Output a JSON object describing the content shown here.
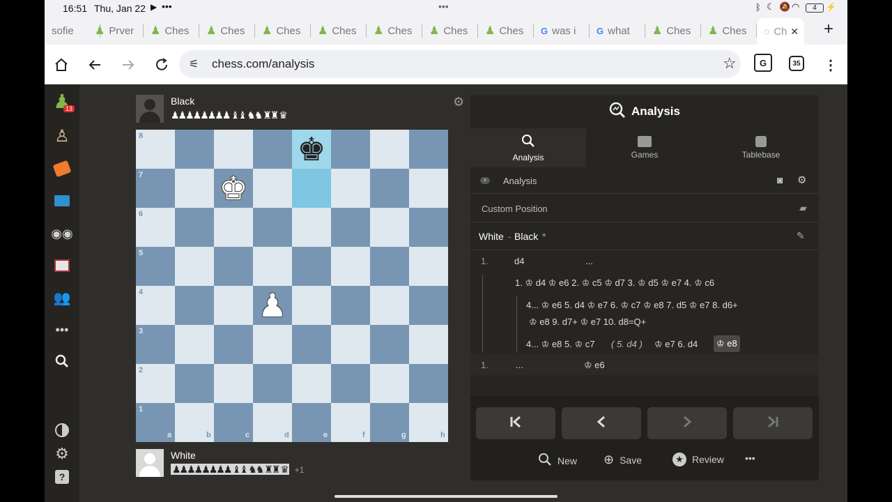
{
  "status": {
    "time": "16:51",
    "date": "Thu, Jan 22",
    "battery": "4"
  },
  "tabs": [
    {
      "label": "sofie"
    },
    {
      "label": "Prver"
    },
    {
      "label": "Ches"
    },
    {
      "label": "Ches"
    },
    {
      "label": "Ches"
    },
    {
      "label": "Ches"
    },
    {
      "label": "Ches"
    },
    {
      "label": "Ches"
    },
    {
      "label": "Ches"
    },
    {
      "label": "was i"
    },
    {
      "label": "what"
    },
    {
      "label": "Ches"
    },
    {
      "label": "Ches"
    },
    {
      "label": "Ch"
    }
  ],
  "browser": {
    "url": "chess.com/analysis",
    "tab_count": "35"
  },
  "sidebar": {
    "notification_badge": "13"
  },
  "players": {
    "black": {
      "name": "Black",
      "captured": "♟♟♟♟♟♟♟♟ ♝♝ ♞♞ ♜♜ ♛"
    },
    "white": {
      "name": "White",
      "captured": "♟♟♟♟♟♟♟♟ ♝♝ ♞♞ ♜♜ ♛",
      "advantage": "+1"
    }
  },
  "board": {
    "files": [
      "a",
      "b",
      "c",
      "d",
      "e",
      "f",
      "g",
      "h"
    ],
    "ranks": [
      "8",
      "7",
      "6",
      "5",
      "4",
      "3",
      "2",
      "1"
    ],
    "pieces": [
      {
        "square": "e8",
        "glyph": "♚",
        "color": "black"
      },
      {
        "square": "c7",
        "glyph": "♔",
        "color": "white"
      },
      {
        "square": "d4",
        "glyph": "♙",
        "color": "white"
      }
    ],
    "highlights": [
      "e8",
      "e7"
    ]
  },
  "panel": {
    "title": "Analysis",
    "tabs": [
      {
        "label": "Analysis"
      },
      {
        "label": "Games"
      },
      {
        "label": "Tablebase"
      }
    ],
    "engine_label": "Analysis",
    "custom_position": "Custom Position",
    "game_white": "White",
    "game_dash": "-",
    "game_black": "Black",
    "game_result": "*",
    "moves": {
      "line1_num": "1.",
      "line1_white": "d4",
      "line1_black": "...",
      "var1": "1. ♔ d4  ♔ e6  2. ♔ c5  ♔ d7  3. ♔ d5  ♔ e7  4. ♔ c6",
      "var2a": "4... ♔ e6  5. d4  ♔ e7  6. ♔ c7  ♔ e8  7. d5  ♔ e7  8. d6+",
      "var2b": "♔ e8  9. d7+  ♔ e7  10. d8=Q+",
      "var3a": "4... ♔ e8  5. ♔ c7",
      "var3_paren": "( 5. d4 )",
      "var3b": "♔ e7  6. d4",
      "var3_current": "♔ e8",
      "line2_num": "1.",
      "line2_white": "...",
      "line2_black": "♔ e6"
    },
    "footer": {
      "new": "New",
      "save": "Save",
      "review": "Review",
      "more": "•••"
    }
  },
  "colors": {
    "light_square": "#dfe8ee",
    "dark_square": "#7896b4",
    "highlight": "#9fd8ea",
    "panel_bg": "#262522",
    "page_bg": "#302e2b",
    "accent_green": "#81b64c"
  }
}
